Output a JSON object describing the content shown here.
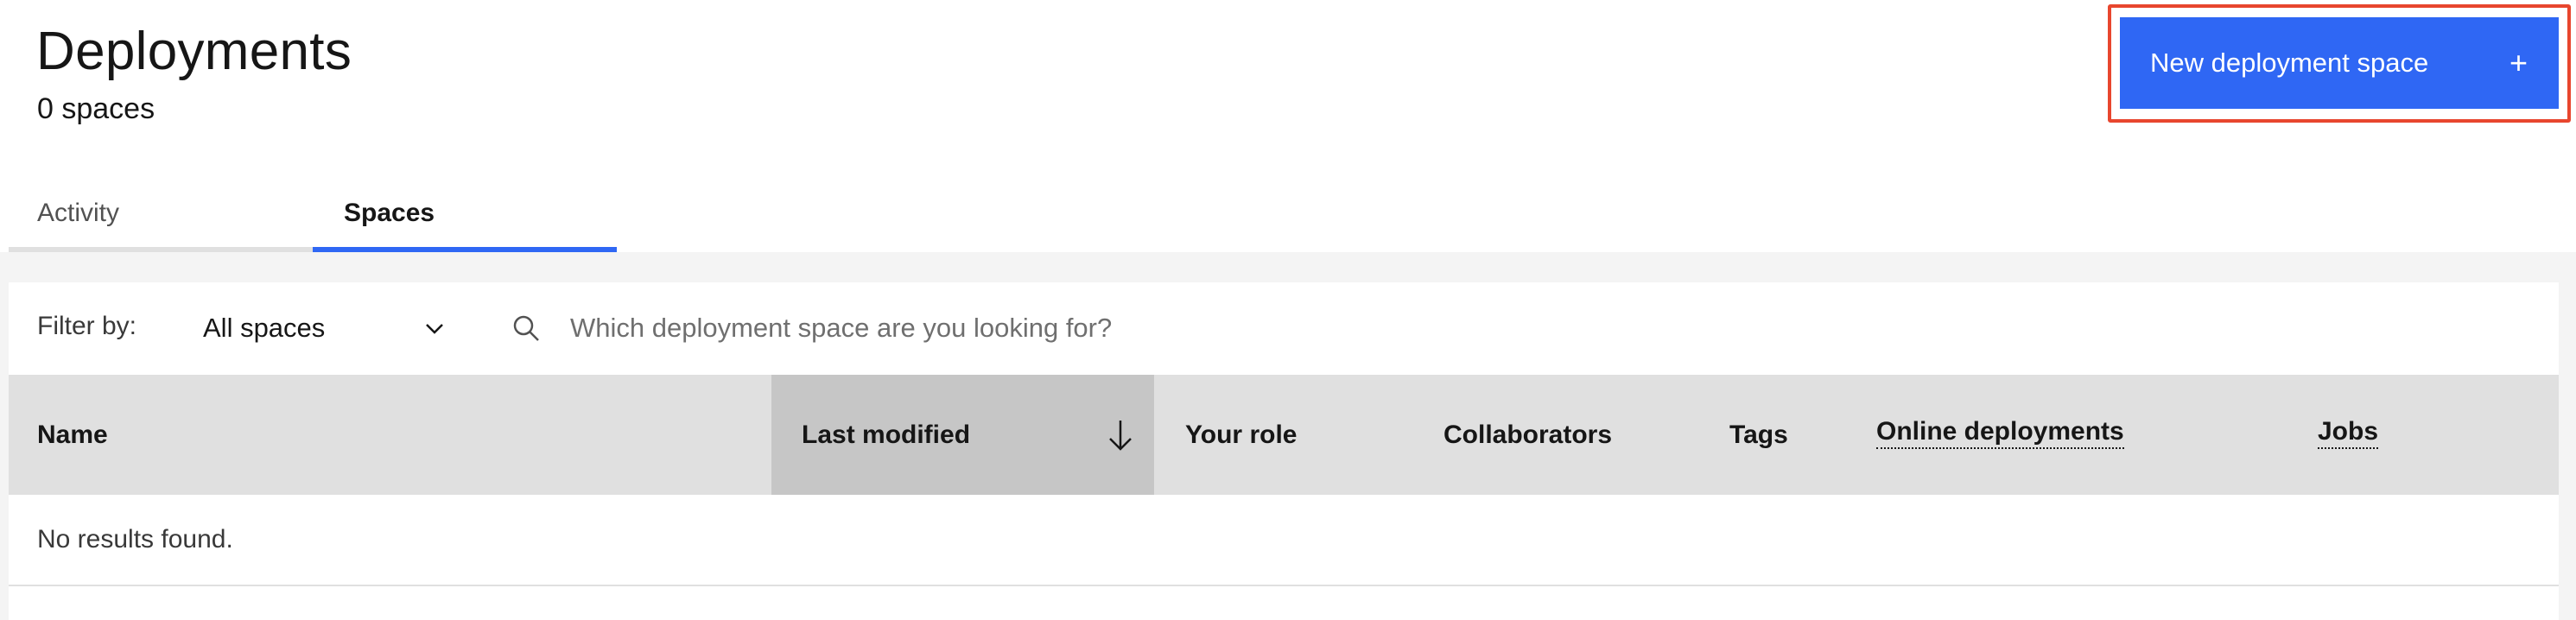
{
  "header": {
    "title": "Deployments",
    "subtitle": "0 spaces",
    "new_space_label": "New deployment space",
    "new_space_icon": "plus-icon"
  },
  "tabs": [
    {
      "label": "Activity",
      "selected": false
    },
    {
      "label": "Spaces",
      "selected": true
    }
  ],
  "toolbar": {
    "filter_label": "Filter by:",
    "filter_value": "All spaces",
    "search_placeholder": "Which deployment space are you looking for?"
  },
  "table": {
    "columns": [
      {
        "label": "Name"
      },
      {
        "label": "Last modified",
        "sorted": "descending"
      },
      {
        "label": "Your role"
      },
      {
        "label": "Collaborators"
      },
      {
        "label": "Tags"
      },
      {
        "label": "Online deployments"
      },
      {
        "label": "Jobs"
      }
    ],
    "empty_message": "No results found."
  },
  "colors": {
    "accent": "#2f67f4",
    "highlight": "#e8462e",
    "header_bg": "#e0e0e0",
    "sorted_header_bg": "#c6c6c6"
  }
}
